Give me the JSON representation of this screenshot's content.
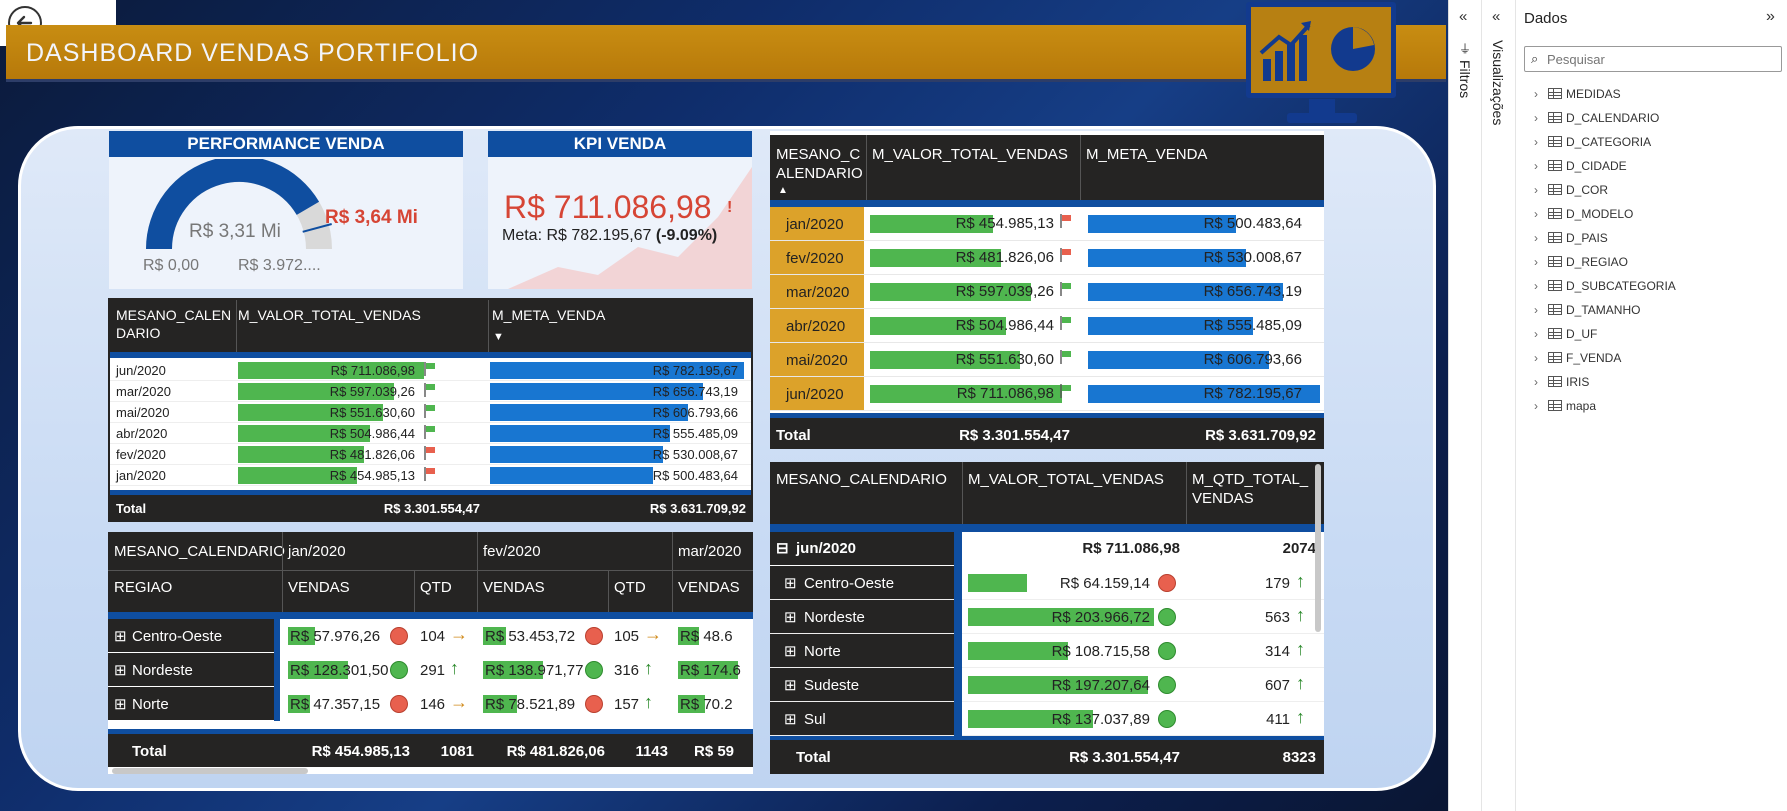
{
  "dashboard": {
    "title": "DASHBOARD VENDAS PORTIFOLIO",
    "perf": {
      "title": "PERFORMANCE VENDA",
      "value": "R$ 3,31 Mi",
      "target": "R$ 3,64 Mi",
      "min": "R$ 0,00",
      "max": "R$ 3.972....",
      "fill_fraction": 0.83
    },
    "kpi": {
      "title": "KPI VENDA",
      "value": "R$ 711.086,98",
      "alert": "!",
      "meta": "Meta: R$ 782.195,67",
      "pct": "(-9.09%)"
    },
    "table1": {
      "headers": [
        "MESANO_CALEN DARIO",
        "M_VALOR_TOTAL_VENDAS",
        "M_META_VENDA"
      ],
      "rows": [
        {
          "m": "jun/2020",
          "v": "R$ 711.086,98",
          "vf": 1.0,
          "flag": "green",
          "meta": "R$ 782.195,67",
          "mf": 1.0
        },
        {
          "m": "mar/2020",
          "v": "R$ 597.039,26",
          "vf": 0.84,
          "flag": "green",
          "meta": "R$ 656.743,19",
          "mf": 0.84
        },
        {
          "m": "mai/2020",
          "v": "R$ 551.630,60",
          "vf": 0.78,
          "flag": "green",
          "meta": "R$ 606.793,66",
          "mf": 0.78
        },
        {
          "m": "abr/2020",
          "v": "R$ 504.986,44",
          "vf": 0.71,
          "flag": "green",
          "meta": "R$ 555.485,09",
          "mf": 0.71
        },
        {
          "m": "fev/2020",
          "v": "R$ 481.826,06",
          "vf": 0.68,
          "flag": "red",
          "meta": "R$ 530.008,67",
          "mf": 0.68
        },
        {
          "m": "jan/2020",
          "v": "R$ 454.985,13",
          "vf": 0.64,
          "flag": "red",
          "meta": "R$ 500.483,64",
          "mf": 0.64
        }
      ],
      "total_label": "Total",
      "total_v": "R$ 3.301.554,47",
      "total_meta": "R$ 3.631.709,92"
    },
    "table2": {
      "headers": [
        "MESANO_C ALENDARIO",
        "M_VALOR_TOTAL_VENDAS",
        "M_META_VENDA"
      ],
      "rows": [
        {
          "m": "jan/2020",
          "v": "R$ 454.985,13",
          "vf": 0.64,
          "flag": "red",
          "meta": "R$ 500.483,64",
          "mf": 0.64
        },
        {
          "m": "fev/2020",
          "v": "R$ 481.826,06",
          "vf": 0.68,
          "flag": "red",
          "meta": "R$ 530.008,67",
          "mf": 0.68
        },
        {
          "m": "mar/2020",
          "v": "R$ 597.039,26",
          "vf": 0.84,
          "flag": "green",
          "meta": "R$ 656.743,19",
          "mf": 0.84
        },
        {
          "m": "abr/2020",
          "v": "R$ 504.986,44",
          "vf": 0.71,
          "flag": "green",
          "meta": "R$ 555.485,09",
          "mf": 0.71
        },
        {
          "m": "mai/2020",
          "v": "R$ 551.630,60",
          "vf": 0.78,
          "flag": "green",
          "meta": "R$ 606.793,66",
          "mf": 0.78
        },
        {
          "m": "jun/2020",
          "v": "R$ 711.086,98",
          "vf": 1.0,
          "flag": "green",
          "meta": "R$ 782.195,67",
          "mf": 1.0
        }
      ],
      "total_label": "Total",
      "total_v": "R$ 3.301.554,47",
      "total_meta": "R$ 3.631.709,92"
    },
    "matrix1": {
      "h1": "MESANO_CALENDARIO",
      "h2": "REGIAO",
      "months": [
        "jan/2020",
        "fev/2020",
        "mar/2020"
      ],
      "sub": [
        "VENDAS",
        "QTD"
      ],
      "rows": [
        {
          "r": "Centro-Oeste",
          "c": [
            {
              "v": "R$ 57.976,26",
              "vf": 0.45,
              "st": "red",
              "q": "104",
              "a": "right"
            },
            {
              "v": "R$ 53.453,72",
              "vf": 0.39,
              "st": "red",
              "q": "105",
              "a": "right"
            },
            {
              "v": "R$ 48.6",
              "vf": 0.35
            }
          ]
        },
        {
          "r": "Nordeste",
          "c": [
            {
              "v": "R$ 128.301,50",
              "vf": 1.0,
              "st": "green",
              "q": "291",
              "a": "up"
            },
            {
              "v": "R$ 138.971,77",
              "vf": 1.0,
              "st": "green",
              "q": "316",
              "a": "up"
            },
            {
              "v": "R$ 174.6",
              "vf": 1.0
            }
          ]
        },
        {
          "r": "Norte",
          "c": [
            {
              "v": "R$ 47.357,15",
              "vf": 0.37,
              "st": "red",
              "q": "146",
              "a": "right"
            },
            {
              "v": "R$ 78.521,89",
              "vf": 0.57,
              "st": "red",
              "q": "157",
              "a": "up"
            },
            {
              "v": "R$ 70.2",
              "vf": 0.45
            }
          ]
        }
      ],
      "total_label": "Total",
      "totals": [
        "R$ 454.985,13",
        "1081",
        "R$ 481.826,06",
        "1143",
        "R$ 59"
      ]
    },
    "matrix2": {
      "headers": [
        "MESANO_CALENDARIO",
        "M_VALOR_TOTAL_VENDAS",
        "M_QTD_TOTAL_ VENDAS"
      ],
      "group": {
        "m": "jun/2020",
        "v": "R$ 711.086,98",
        "q": "2074"
      },
      "rows": [
        {
          "r": "Centro-Oeste",
          "v": "R$ 64.159,14",
          "vf": 0.3,
          "st": "red",
          "q": "179"
        },
        {
          "r": "Nordeste",
          "v": "R$ 203.966,72",
          "vf": 0.95,
          "st": "green",
          "q": "563"
        },
        {
          "r": "Norte",
          "v": "R$ 108.715,58",
          "vf": 0.51,
          "st": "green",
          "q": "314"
        },
        {
          "r": "Sudeste",
          "v": "R$ 197.207,64",
          "vf": 0.92,
          "st": "green",
          "q": "607"
        },
        {
          "r": "Sul",
          "v": "R$ 137.037,89",
          "vf": 0.64,
          "st": "green",
          "q": "411"
        }
      ],
      "total_label": "Total",
      "total_v": "R$ 3.301.554,47",
      "total_q": "8323"
    }
  },
  "panes": {
    "filtros": "Filtros",
    "visualizacoes": "Visualizações",
    "dados": "Dados",
    "search_placeholder": "Pesquisar",
    "fields": [
      "MEDIDAS",
      "D_CALENDARIO",
      "D_CATEGORIA",
      "D_CIDADE",
      "D_COR",
      "D_MODELO",
      "D_PAIS",
      "D_REGIAO",
      "D_SUBCATEGORIA",
      "D_TAMANHO",
      "D_UF",
      "F_VENDA",
      "IRIS",
      "mapa"
    ]
  },
  "colors": {
    "accent": "#0f4ea0",
    "gold": "#c88d12",
    "green": "#4fb64f",
    "blue": "#1876d1",
    "red": "#e8604e"
  }
}
